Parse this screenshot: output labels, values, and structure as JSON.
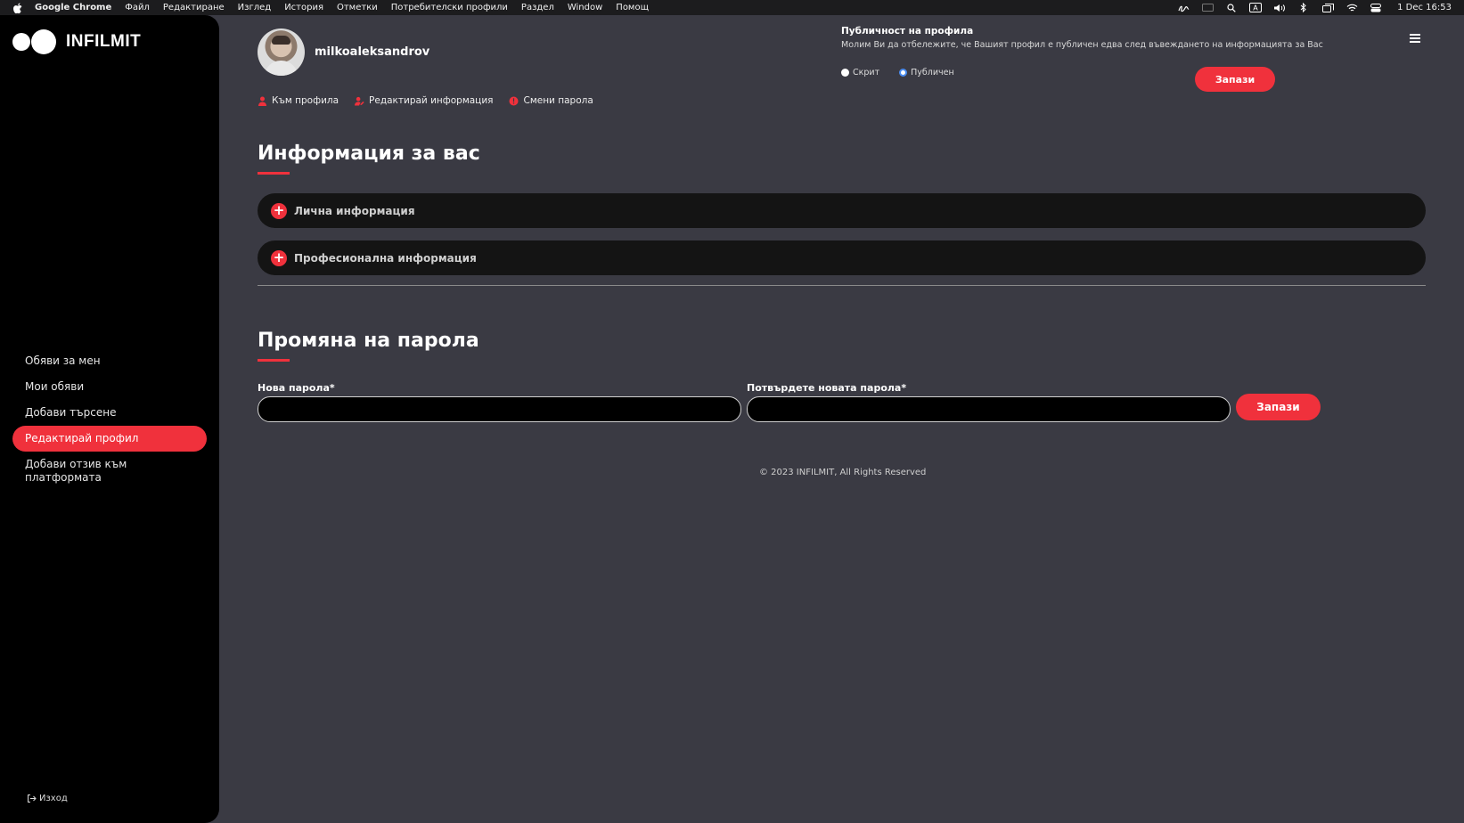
{
  "menubar": {
    "app": "Google Chrome",
    "items": [
      "Файл",
      "Редактиране",
      "Изглед",
      "История",
      "Отметки",
      "Потребителски профили",
      "Раздел",
      "Window",
      "Помощ"
    ],
    "clock": "1 Dec  16:53"
  },
  "sidebar": {
    "logo": "INFILMIT",
    "items": [
      {
        "label": "Обяви за мен"
      },
      {
        "label": "Мои обяви"
      },
      {
        "label": "Добави търсене"
      },
      {
        "label": "Редактирай профил"
      },
      {
        "label": "Добави отзив към платформата"
      }
    ],
    "logout": "Изход"
  },
  "profile": {
    "username": "milkoaleksandrov",
    "tabs": [
      {
        "label": "Към профила",
        "icon": "user-icon"
      },
      {
        "label": "Редактирай информация",
        "icon": "user-edit-icon"
      },
      {
        "label": "Смени парола",
        "icon": "alert-icon"
      }
    ]
  },
  "publicity": {
    "title": "Публичност на профила",
    "description": "Молим Ви да отбележите, че Вашият профил е публичен едва след въвеждането на информацията за Вас",
    "options": [
      "Скрит",
      "Публичен"
    ],
    "selected": "Публичен",
    "save_label": "Запази"
  },
  "info_section": {
    "title": "Информация за вас",
    "panels": [
      "Лична информация",
      "Професионална информация"
    ]
  },
  "password_section": {
    "title": "Промяна на парола",
    "new_label": "Нова парола*",
    "confirm_label": "Потвърдете новата парола*",
    "new_value": "",
    "confirm_value": "",
    "save_label": "Запази"
  },
  "footer": "© 2023 INFILMIT, All Rights Reserved",
  "colors": {
    "accent": "#f0313c",
    "background": "#3a3a43",
    "sidebar": "#000000"
  }
}
